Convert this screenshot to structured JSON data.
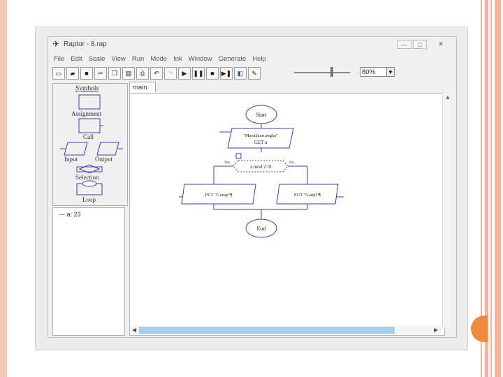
{
  "window": {
    "title": "Raptor - 8.rap",
    "min_label": "—",
    "max_label": "□",
    "close_label": "✕"
  },
  "menu": [
    "File",
    "Edit",
    "Scale",
    "View",
    "Run",
    "Mode",
    "Ink",
    "Window",
    "Generate",
    "Help"
  ],
  "toolbar": {
    "buttons": [
      "new-icon",
      "open-icon",
      "save-icon",
      "cut-icon",
      "copy-icon",
      "paste-icon",
      "print-icon",
      "undo-icon",
      "redo-icon",
      "play-icon",
      "pause-icon",
      "stop-icon",
      "step-icon",
      "step-to-icon",
      "pen-icon"
    ],
    "zoom": "80%"
  },
  "symbols": {
    "title": "Symbols",
    "assignment": "Assignment",
    "call": "Call",
    "input": "Input",
    "output": "Output",
    "selection": "Selection",
    "loop": "Loop"
  },
  "variables": {
    "line": "--- a: 23"
  },
  "tab": {
    "label": "main"
  },
  "flowchart": {
    "start": "Start",
    "input_prompt": "\"Masukkan angka\"",
    "input_get": "GET a",
    "condition": "a mod 2=0",
    "yes": "Yes",
    "no": "No",
    "put_left": "PUT \"Genap\"¶",
    "put_right": "PUT \"Ganjil\"¶",
    "end": "End"
  },
  "colors": {
    "flow_line": "#3a3fb3",
    "accent": "#f08a3c",
    "slide_stripe": "#f3b59b"
  }
}
